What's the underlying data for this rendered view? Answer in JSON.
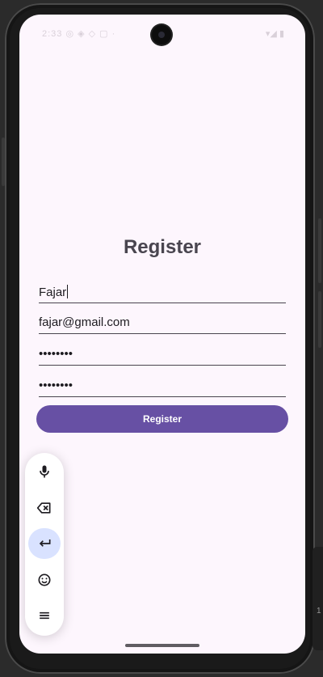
{
  "status_bar": {
    "left_text": "2:33 ◎ ◈ ◇ ▢ ·",
    "right_text": "▾◢ ▮"
  },
  "page": {
    "title": "Register"
  },
  "form": {
    "name_value": "Fajar",
    "email_value": "fajar@gmail.com",
    "password_value": "••••••••",
    "confirm_password_value": "••••••••",
    "submit_label": "Register"
  },
  "keyboard_toolbar": {
    "items": [
      {
        "icon": "microphone-icon"
      },
      {
        "icon": "backspace-icon"
      },
      {
        "icon": "enter-icon"
      },
      {
        "icon": "emoji-icon"
      },
      {
        "icon": "menu-icon"
      }
    ],
    "accent": "#d9e2ff"
  },
  "edge_widget": {
    "digit": "1"
  },
  "colors": {
    "background": "#fdf6fd",
    "primary": "#6750a4",
    "text": "#49454f"
  }
}
